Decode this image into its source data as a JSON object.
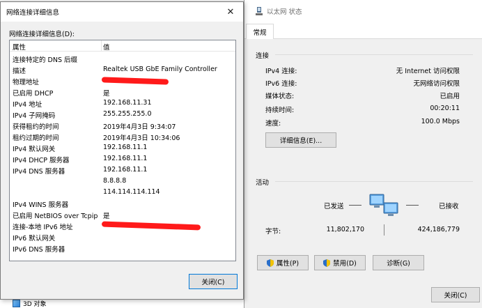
{
  "background": {
    "explorer_item": "3D 对象"
  },
  "status_window": {
    "title": "以太网 状态",
    "tab": "常规",
    "connection_group": "连接",
    "rows": [
      {
        "label": "IPv4 连接:",
        "value": "无 Internet 访问权限"
      },
      {
        "label": "IPv6 连接:",
        "value": "无网络访问权限"
      },
      {
        "label": "媒体状态:",
        "value": "已启用"
      },
      {
        "label": "持续时间:",
        "value": "00:20:11"
      },
      {
        "label": "速度:",
        "value": "100.0 Mbps"
      }
    ],
    "details_button": "详细信息(E)...",
    "activity_group": "活动",
    "sent_label": "已发送",
    "received_label": "已接收",
    "bytes_label": "字节:",
    "bytes_sent": "11,802,170",
    "bytes_received": "424,186,779",
    "properties_button": "属性(P)",
    "disable_button": "禁用(D)",
    "diagnose_button": "诊断(G)",
    "close_button": "关闭(C)"
  },
  "details_dialog": {
    "title": "网络连接详细信息",
    "caption": "网络连接详细信息(D):",
    "col_property": "属性",
    "col_value": "值",
    "rows": [
      {
        "property": "连接特定的 DNS 后缀",
        "value": ""
      },
      {
        "property": "描述",
        "value": "Realtek USB GbE Family Controller"
      },
      {
        "property": "物理地址",
        "value": ""
      },
      {
        "property": "已启用 DHCP",
        "value": "是"
      },
      {
        "property": "IPv4 地址",
        "value": "192.168.11.31"
      },
      {
        "property": "IPv4 子网掩码",
        "value": "255.255.255.0"
      },
      {
        "property": "获得租约的时间",
        "value": "2019年4月3日 9:34:07"
      },
      {
        "property": "租约过期的时间",
        "value": "2019年4月3日 10:34:06"
      },
      {
        "property": "IPv4 默认网关",
        "value": "192.168.11.1"
      },
      {
        "property": "IPv4 DHCP 服务器",
        "value": "192.168.11.1"
      },
      {
        "property": "IPv4 DNS 服务器",
        "value": "192.168.11.1"
      },
      {
        "property": "",
        "value": "8.8.8.8"
      },
      {
        "property": "",
        "value": "114.114.114.114"
      },
      {
        "property": "IPv4 WINS 服务器",
        "value": ""
      },
      {
        "property": "已启用 NetBIOS over Tcpip",
        "value": "是"
      },
      {
        "property": "连接-本地 IPv6 地址",
        "value": ""
      },
      {
        "property": "IPv6 默认网关",
        "value": ""
      },
      {
        "property": "IPv6 DNS 服务器",
        "value": ""
      }
    ],
    "close_button": "关闭(C)"
  },
  "colors": {
    "dialog_bg": "#f0f0f0",
    "redaction": "#ff1a1a",
    "button_focus_border": "#0078d7"
  }
}
